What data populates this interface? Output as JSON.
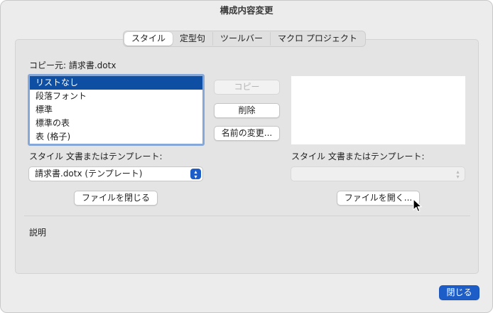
{
  "window": {
    "title": "構成内容変更"
  },
  "tabs": [
    {
      "label": "スタイル",
      "active": true
    },
    {
      "label": "定型句",
      "active": false
    },
    {
      "label": "ツールバー",
      "active": false
    },
    {
      "label": "マクロ プロジェクト",
      "active": false
    }
  ],
  "left": {
    "copy_from_label": "コピー元: 請求書.dotx",
    "styles": [
      {
        "label": "リストなし",
        "selected": true
      },
      {
        "label": "段落フォント",
        "selected": false
      },
      {
        "label": "標準",
        "selected": false
      },
      {
        "label": "標準の表",
        "selected": false
      },
      {
        "label": "表 (格子)",
        "selected": false
      }
    ],
    "available_in_label": "スタイル 文書またはテンプレート:",
    "available_in_value": "請求書.dotx (テンプレート)",
    "close_file_button": "ファイルを閉じる"
  },
  "middle": {
    "copy_button": "コピー",
    "delete_button": "削除",
    "rename_button": "名前の変更..."
  },
  "right": {
    "available_in_label": "スタイル 文書またはテンプレート:",
    "available_in_value": "",
    "open_file_button": "ファイルを開く..."
  },
  "description": {
    "label": "説明",
    "text": ""
  },
  "footer": {
    "close_button": "閉じる"
  },
  "colors": {
    "accent": "#1c5dc7",
    "selection": "#0e4fa3"
  }
}
